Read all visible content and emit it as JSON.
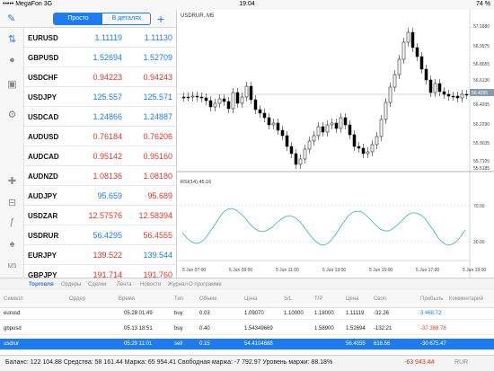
{
  "status_bar": {
    "carrier": "••••• MegaFon  3G",
    "time": "19:04",
    "battery": "74 %"
  },
  "nav": {
    "tab_simple": "Просто",
    "tab_detailed": "В деталях"
  },
  "quotes": [
    {
      "symbol": "EURUSD",
      "bid": "1.11119",
      "ask": "1.11130",
      "bid_color": "blue",
      "ask_color": "blue"
    },
    {
      "symbol": "GBPUSD",
      "bid": "1.52694",
      "ask": "1.52709",
      "bid_color": "blue",
      "ask_color": "blue"
    },
    {
      "symbol": "USDCHF",
      "bid": "0.94223",
      "ask": "0.94243",
      "bid_color": "red",
      "ask_color": "red"
    },
    {
      "symbol": "USDJPY",
      "bid": "125.557",
      "ask": "125.571",
      "bid_color": "blue",
      "ask_color": "blue"
    },
    {
      "symbol": "USDCAD",
      "bid": "1.24866",
      "ask": "1.24887",
      "bid_color": "blue",
      "ask_color": "blue"
    },
    {
      "symbol": "AUDUSD",
      "bid": "0.76184",
      "ask": "0.76206",
      "bid_color": "red",
      "ask_color": "red"
    },
    {
      "symbol": "AUDCAD",
      "bid": "0.95142",
      "ask": "0.95160",
      "bid_color": "red",
      "ask_color": "red"
    },
    {
      "symbol": "AUDNZD",
      "bid": "1.08136",
      "ask": "1.08180",
      "bid_color": "red",
      "ask_color": "red"
    },
    {
      "symbol": "AUDJPY",
      "bid": "95.659",
      "ask": "95.689",
      "bid_color": "blue",
      "ask_color": "red"
    },
    {
      "symbol": "USDZAR",
      "bid": "12.57576",
      "ask": "12.58394",
      "bid_color": "red",
      "ask_color": "red"
    },
    {
      "symbol": "USDRUR",
      "bid": "56.4295",
      "ask": "56.4555",
      "bid_color": "blue",
      "ask_color": "red"
    },
    {
      "symbol": "EURJPY",
      "bid": "139.522",
      "ask": "139.544",
      "bid_color": "red",
      "ask_color": "blue"
    },
    {
      "symbol": "GBPJPY",
      "bid": "191.714",
      "ask": "191.760",
      "bid_color": "red",
      "ask_color": "red"
    }
  ],
  "chart": {
    "title": "USDRUR, M5",
    "price_ticks": [
      "57.1880",
      "56.9975",
      "56.8055",
      "56.6130",
      "56.4205",
      "56.2290",
      "55.9035",
      "55.7105",
      "55.5185"
    ],
    "current_price": "56.4295",
    "rsi_label": "RSI(14) 45.16",
    "rsi_ticks": [
      "70.00",
      "30.00"
    ],
    "time_ticks": [
      "5 Jun 07:00",
      "5 Jun 09:00",
      "5 Jun 11:00",
      "5 Jun 13:00",
      "5 Jun 15:00",
      "5 Jun 17:00",
      "5 Jun 19:00"
    ]
  },
  "terminal_tabs": [
    "Торговля",
    "Ордеры",
    "Сделки",
    "Лента",
    "Новости",
    "Журнал",
    "О программе"
  ],
  "table_headers": [
    "Символ",
    "Ордер",
    "Время",
    "Тип",
    "Объем",
    "Цена",
    "S/L",
    "T/P",
    "Цена",
    "Своп",
    "Прибыль",
    "Комментарий"
  ],
  "trades": [
    {
      "symbol": "eurusd",
      "time": "05.28 01:49",
      "type": "buy",
      "volume": "0.03",
      "price": "1.09070",
      "sl": "1.10000",
      "tp": "1.18000",
      "cur": "1.11119",
      "swap": "-32.26",
      "profit": "3 468.72",
      "profit_color": "blue"
    },
    {
      "symbol": "gbpusd",
      "time": "05.13 18:51",
      "type": "buy",
      "volume": "0.40",
      "price": "1.54349669",
      "sl": "",
      "tp": "1.58900",
      "cur": "1.52694",
      "swap": "-132.21",
      "profit": "-37 388.78",
      "profit_color": "red"
    },
    {
      "symbol": "usdrur",
      "time": "05.29 11:01",
      "type": "sell",
      "volume": "0.15",
      "price": "54.4104688",
      "sl": "",
      "tp": "",
      "cur": "56.4555",
      "swap": "616.56",
      "profit": "-30 675.47",
      "profit_color": "red"
    }
  ],
  "footer": {
    "summary": "Баланс: 122 104.88 Средства: 58 161.44 Маржа: 65 954.41 Свободная маржа: -7 792.97 Уровень маржи: 88.18%",
    "total": "-63 943.44",
    "currency": "RUR"
  }
}
